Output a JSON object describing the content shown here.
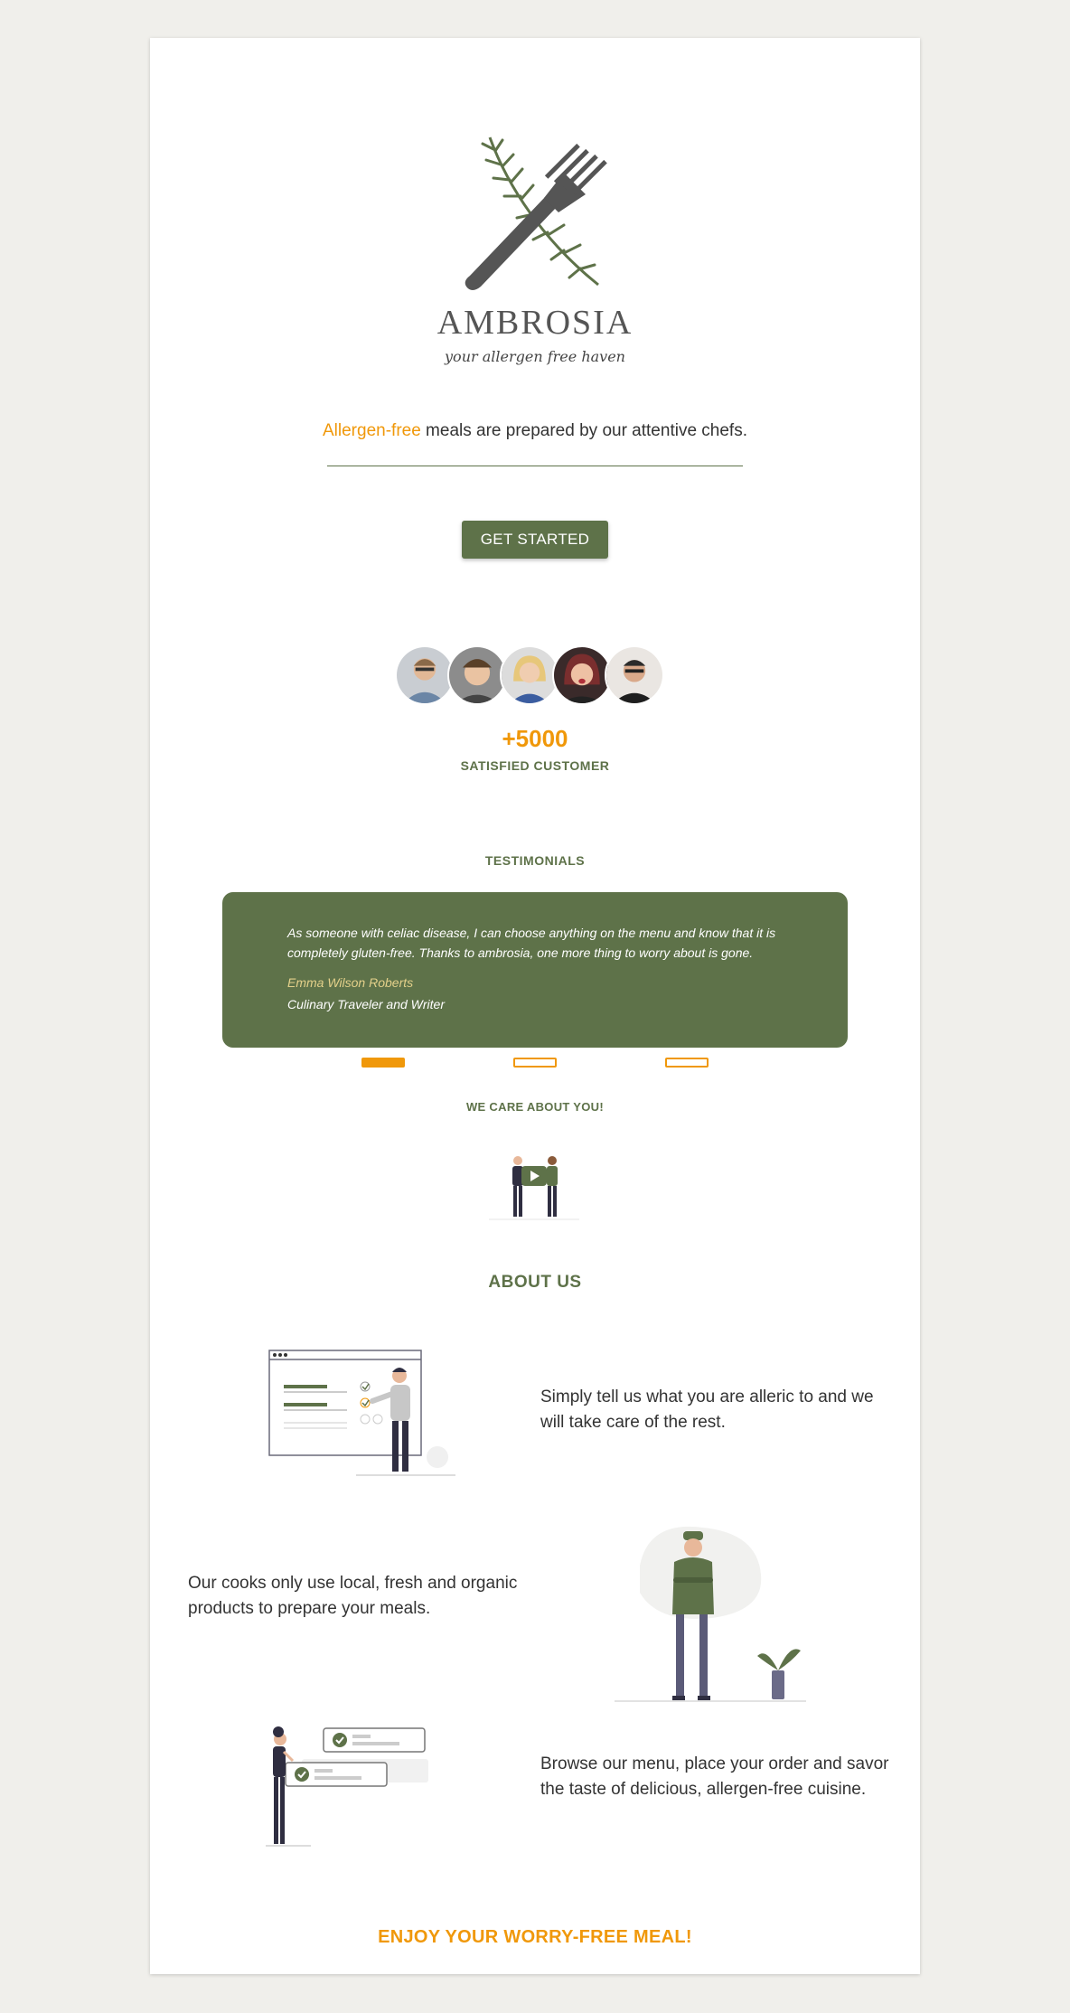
{
  "brand": {
    "name": "AMBROSIA",
    "tagline_script": "your allergen free haven"
  },
  "hero": {
    "accent_text": "Allergen-free",
    "rest_text": " meals are prepared by our attentive chefs.",
    "cta_label": "GET STARTED"
  },
  "social_proof": {
    "count": "+5000",
    "label": "SATISFIED CUSTOMER"
  },
  "testimonials": {
    "title": "TESTIMONIALS",
    "quote": "As someone with celiac disease, I can choose anything on the menu and know that it is completely gluten-free. Thanks to ambrosia, one more thing to worry about is gone.",
    "author": "Emma Wilson Roberts",
    "role": "Culinary Traveler and Writer",
    "active_index": 0,
    "slide_count": 3
  },
  "care": {
    "title": "WE CARE ABOUT YOU!"
  },
  "about": {
    "title": "ABOUT US",
    "features": [
      {
        "text": "Simply tell us what you are alleric to and we will take care of the rest."
      },
      {
        "text": "Our cooks only use local, fresh and organic products to prepare your meals."
      },
      {
        "text": "Browse our menu, place your order and savor the taste of delicious, allergen-free cuisine."
      }
    ]
  },
  "footer": {
    "cta": "ENJOY YOUR WORRY-FREE MEAL!"
  },
  "colors": {
    "page_bg": "#f0efeb",
    "card_bg": "#ffffff",
    "primary_green": "#5e7249",
    "accent_orange": "#f0980a",
    "text": "#333333"
  }
}
